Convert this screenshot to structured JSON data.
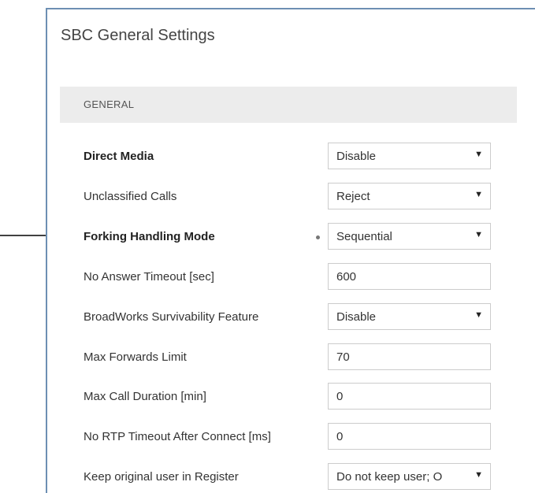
{
  "page": {
    "title": "SBC General Settings"
  },
  "section": {
    "title": "GENERAL"
  },
  "fields": [
    {
      "label": "Direct Media",
      "bold": true,
      "type": "select",
      "value": "Disable"
    },
    {
      "label": "Unclassified Calls",
      "bold": false,
      "type": "select",
      "value": "Reject"
    },
    {
      "label": "Forking Handling Mode",
      "bold": true,
      "type": "select",
      "value": "Sequential",
      "modified": true
    },
    {
      "label": "No Answer Timeout [sec]",
      "bold": false,
      "type": "text",
      "value": "600"
    },
    {
      "label": "BroadWorks Survivability Feature",
      "bold": false,
      "type": "select",
      "value": "Disable"
    },
    {
      "label": "Max Forwards Limit",
      "bold": false,
      "type": "text",
      "value": "70"
    },
    {
      "label": "Max Call Duration [min]",
      "bold": false,
      "type": "text",
      "value": "0"
    },
    {
      "label": "No RTP Timeout After Connect [ms]",
      "bold": false,
      "type": "text",
      "value": "0"
    },
    {
      "label": "Keep original user in Register",
      "bold": false,
      "type": "select",
      "value": "Do not keep user; O"
    }
  ],
  "icons": {
    "dropdown": "chevron-down-icon",
    "modified_indicator": "dot-icon",
    "pointer": "arrow-right-icon"
  },
  "colors": {
    "panel_border": "#6d8fb3",
    "section_bg": "#ececec"
  }
}
